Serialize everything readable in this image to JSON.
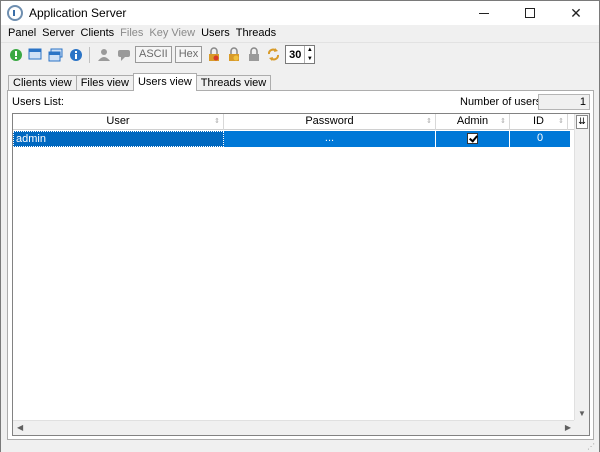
{
  "window": {
    "title": "Application Server"
  },
  "menu": {
    "items": [
      {
        "label": "Panel",
        "disabled": false
      },
      {
        "label": "Server",
        "disabled": false
      },
      {
        "label": "Clients",
        "disabled": false
      },
      {
        "label": "Files",
        "disabled": true
      },
      {
        "label": "Key View",
        "disabled": true
      },
      {
        "label": "Users",
        "disabled": false
      },
      {
        "label": "Threads",
        "disabled": false
      }
    ]
  },
  "toolbar": {
    "ascii_label": "ASCII",
    "hex_label": "Hex",
    "refresh_value": "30",
    "colors": {
      "green": "#3aa843",
      "blue": "#2b74c6",
      "lock": "#d89b2a"
    }
  },
  "tabs": [
    {
      "label": "Clients view",
      "active": false
    },
    {
      "label": "Files view",
      "active": false
    },
    {
      "label": "Users view",
      "active": true
    },
    {
      "label": "Threads view",
      "active": false
    }
  ],
  "users_panel": {
    "list_label": "Users List:",
    "count_label": "Number of users:",
    "count_value": "1"
  },
  "grid": {
    "columns": [
      "User",
      "Password",
      "Admin",
      "ID"
    ],
    "rows": [
      {
        "user": "admin",
        "password": "...",
        "admin": true,
        "id": "0"
      }
    ],
    "selection_color": "#0078d7"
  }
}
